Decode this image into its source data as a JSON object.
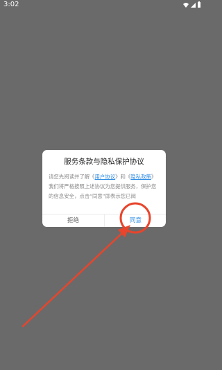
{
  "status_bar": {
    "time": "3:02",
    "icons": [
      "wifi-icon",
      "signal-icon",
      "battery-icon"
    ]
  },
  "dialog": {
    "title": "服务条款与隐私保护协议",
    "body_intro": "请您先阅读并了解《",
    "link_user_agreement": "用户协议",
    "body_mid": "》和《",
    "link_privacy_policy": "隐私政策",
    "body_rest": "》我们将严格按照上述协议为您提供服务，保护您的信息安全，点击“同意”即表示您已阅",
    "reject_label": "拒绝",
    "agree_label": "同意"
  },
  "annotation": {
    "color": "#e8452c"
  },
  "colors": {
    "backdrop": "#6a6a6a",
    "link": "#2f8de4",
    "dialog_bg": "#ffffff"
  }
}
